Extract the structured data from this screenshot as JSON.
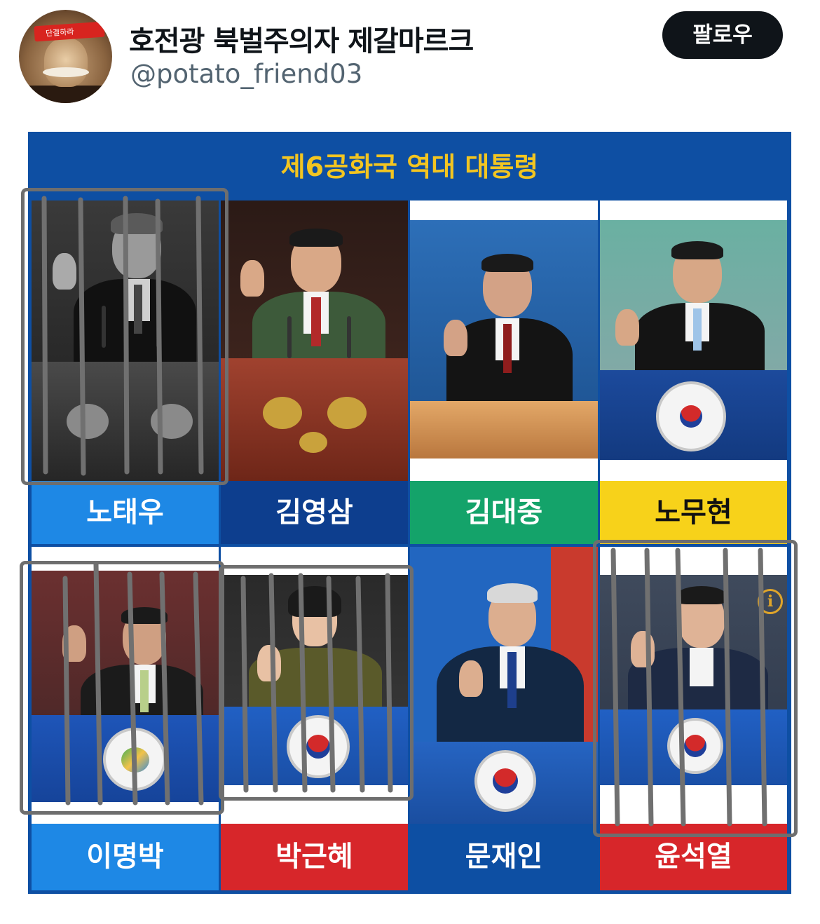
{
  "tweet": {
    "display_name": "호전광 북벌주의자 제갈마르크",
    "handle": "@potato_friend03",
    "follow_label": "팔로우",
    "avatar_band_text": "단결하라"
  },
  "media": {
    "title": "제6공화국 역대 대통령",
    "presidents": [
      {
        "name": "노태우",
        "bar_color": "#1e88e5",
        "text_color": "#ffffff",
        "barred": true
      },
      {
        "name": "김영삼",
        "bar_color": "#0d3e8e",
        "text_color": "#ffffff",
        "barred": false
      },
      {
        "name": "김대중",
        "bar_color": "#14a36a",
        "text_color": "#ffffff",
        "barred": false
      },
      {
        "name": "노무현",
        "bar_color": "#f7d21a",
        "text_color": "#111111",
        "barred": false
      },
      {
        "name": "이명박",
        "bar_color": "#1e88e5",
        "text_color": "#ffffff",
        "barred": true
      },
      {
        "name": "박근혜",
        "bar_color": "#d7262a",
        "text_color": "#ffffff",
        "barred": true
      },
      {
        "name": "문재인",
        "bar_color": "#0d4fa3",
        "text_color": "#ffffff",
        "barred": false
      },
      {
        "name": "윤석열",
        "bar_color": "#d7262a",
        "text_color": "#ffffff",
        "barred": true
      }
    ],
    "info_icon": "info-icon"
  }
}
